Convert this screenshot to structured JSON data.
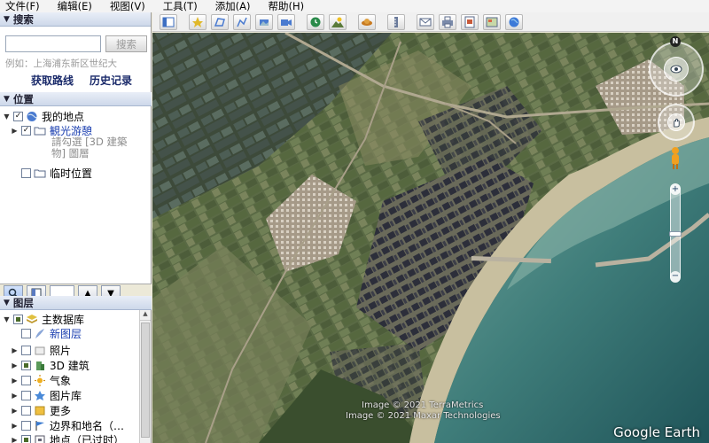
{
  "menu": [
    "文件(F)",
    "编辑(E)",
    "视图(V)",
    "工具(T)",
    "添加(A)",
    "帮助(H)"
  ],
  "toolbar": {
    "buttons": [
      {
        "icon": "sidebar-toggle-icon",
        "color": "#3d6fc2"
      },
      {
        "icon": "add-placemark-icon",
        "color": "#e0b82a"
      },
      {
        "icon": "add-polygon-icon",
        "color": "#4a7bd0"
      },
      {
        "icon": "add-path-icon",
        "color": "#4a7bd0"
      },
      {
        "icon": "add-image-overlay-icon",
        "color": "#4a7bd0"
      },
      {
        "icon": "record-tour-icon",
        "color": "#4a7bd0"
      },
      {
        "icon": "historical-imagery-icon",
        "color": "#2a8a4a"
      },
      {
        "icon": "sunlight-icon",
        "color": "#d8a020"
      },
      {
        "icon": "switch-to-sky-icon",
        "color": "#c87a20"
      },
      {
        "icon": "ruler-icon",
        "color": "#5a6a8a"
      },
      {
        "icon": "email-icon",
        "color": "#5a6a8a"
      },
      {
        "icon": "print-icon",
        "color": "#5a6a8a"
      },
      {
        "icon": "save-image-icon",
        "color": "#5a6a8a"
      },
      {
        "icon": "view-in-maps-icon",
        "color": "#5a6a8a"
      },
      {
        "icon": "earth-gallery-icon",
        "color": "#3d7ad8"
      }
    ]
  },
  "search": {
    "header": "搜索",
    "input_value": "",
    "button_label": "搜索",
    "example_text": "例如：上海浦东新区世纪大",
    "links": [
      "获取路线",
      "历史记录"
    ]
  },
  "places": {
    "header": "位置",
    "items": [
      {
        "label": "我的地点",
        "checked": true
      },
      {
        "label": "観光游憩",
        "checked": true
      },
      {
        "label": "临时位置",
        "checked": false
      }
    ],
    "hint": "請勾選 [3D 建築物] 圖層"
  },
  "layers": {
    "header": "图层",
    "items": [
      {
        "label": "主数据库"
      },
      {
        "label": "新图层"
      },
      {
        "label": "照片"
      },
      {
        "label": "3D 建筑"
      },
      {
        "label": "气象"
      },
      {
        "label": "图片库"
      },
      {
        "label": "更多"
      },
      {
        "label": "边界和地名（…"
      },
      {
        "label": "地点（已过时）"
      }
    ]
  },
  "map": {
    "credits": [
      "Image © 2021 TerraMetrics",
      "Image © 2021 Maxar Technologies"
    ],
    "logo": "Google Earth",
    "compass_letter": "N"
  }
}
